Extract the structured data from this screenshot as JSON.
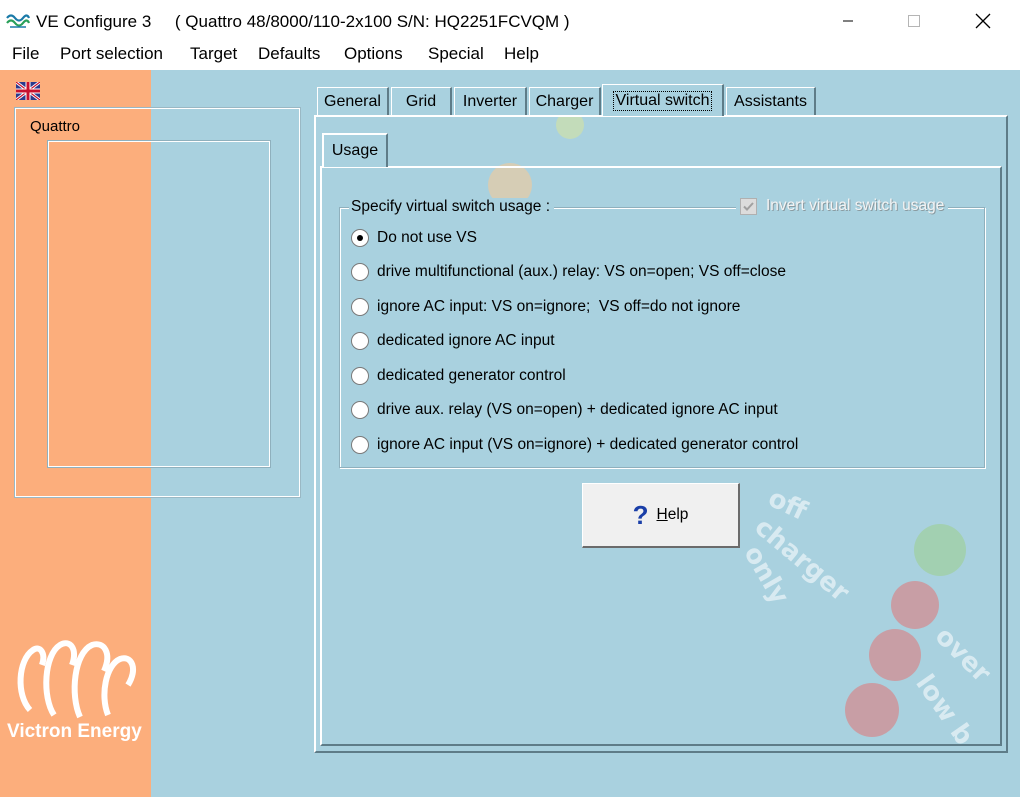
{
  "window": {
    "app_title": "VE Configure 3",
    "device_info": "( Quattro 48/8000/110-2x100 S/N: HQ2251FCVQM )",
    "icon": "victron-wave-icon",
    "controls": {
      "minimize": "minimize-icon",
      "maximize": "maximize-icon",
      "close": "close-icon"
    }
  },
  "menu": {
    "items": [
      "File",
      "Port selection",
      "Target",
      "Defaults",
      "Options",
      "Special",
      "Help"
    ]
  },
  "left_panel": {
    "flag_icon": "uk-flag-icon",
    "device_name": "Quattro",
    "brand": "Victron Energy",
    "band_color": "#fcae7c"
  },
  "tabs": [
    {
      "label": "General",
      "active": false
    },
    {
      "label": "Grid",
      "active": false
    },
    {
      "label": "Inverter",
      "active": false
    },
    {
      "label": "Charger",
      "active": false
    },
    {
      "label": "Virtual switch",
      "active": true
    },
    {
      "label": "Assistants",
      "active": false
    }
  ],
  "subtab": {
    "label": "Usage"
  },
  "usage": {
    "group_label": "Specify virtual switch usage :",
    "invert": {
      "label": "Invert virtual switch usage",
      "checked": true,
      "enabled": false
    },
    "options": [
      {
        "label": "Do not use VS",
        "selected": true
      },
      {
        "label": "drive multifunctional (aux.) relay: VS on=open; VS off=close",
        "selected": false
      },
      {
        "label": "ignore AC input: VS on=ignore;  VS off=do not ignore",
        "selected": false
      },
      {
        "label": "dedicated ignore AC input",
        "selected": false
      },
      {
        "label": "dedicated generator control",
        "selected": false
      },
      {
        "label": "drive aux. relay (VS on=open) + dedicated ignore AC input",
        "selected": false
      },
      {
        "label": "ignore AC input (VS on=ignore) + dedicated generator control",
        "selected": false
      }
    ]
  },
  "help_button": {
    "mnemonic": "H",
    "rest": "elp",
    "icon": "question-icon"
  },
  "colors": {
    "client_bg": "#a9d1df",
    "accent_blue": "#1a3fa8"
  }
}
